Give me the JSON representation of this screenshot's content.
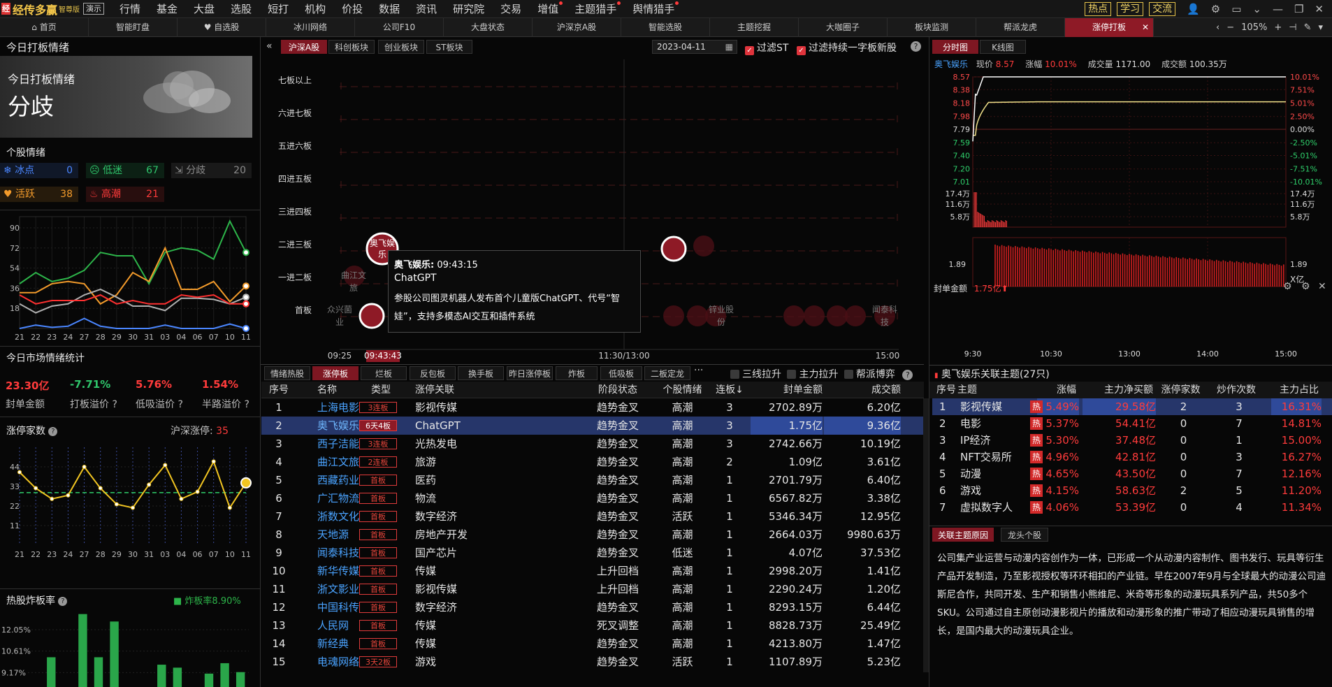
{
  "app": {
    "logo_mark": "经",
    "brand": "经传多赢",
    "edition": "智尊版",
    "demo": "演示"
  },
  "menu": [
    {
      "label": "行情",
      "hot": false
    },
    {
      "label": "基金",
      "hot": false
    },
    {
      "label": "大盘",
      "hot": false
    },
    {
      "label": "选股",
      "hot": false
    },
    {
      "label": "短打",
      "hot": false
    },
    {
      "label": "机构",
      "hot": false
    },
    {
      "label": "价投",
      "hot": false
    },
    {
      "label": "数据",
      "hot": false
    },
    {
      "label": "资讯",
      "hot": false
    },
    {
      "label": "研究院",
      "hot": false
    },
    {
      "label": "交易",
      "hot": false
    },
    {
      "label": "增值",
      "hot": true
    },
    {
      "label": "主题猎手",
      "hot": true
    },
    {
      "label": "舆情猎手",
      "hot": true
    }
  ],
  "top_buttons": [
    "热点",
    "学习",
    "交流"
  ],
  "tabs": [
    "首页",
    "智能盯盘",
    "自选股",
    "冰川网络",
    "公司F10",
    "大盘状态",
    "沪深京A股",
    "智能选股",
    "主题挖掘",
    "大咖圈子",
    "板块监测",
    "帮派龙虎",
    "涨停打板"
  ],
  "zoom": "105%",
  "left": {
    "title": "今日打板情绪",
    "mood_card": {
      "subtitle": "今日打板情绪",
      "mood": "分歧"
    },
    "stock_mood_title": "个股情绪",
    "mood_tags": [
      {
        "label": "冰点",
        "value": "0",
        "color": "#4a86ff"
      },
      {
        "label": "低迷",
        "value": "67",
        "color": "#2fc46b"
      },
      {
        "label": "分歧",
        "value": "20",
        "color": "#8c8c8c"
      },
      {
        "label": "活跃",
        "value": "38",
        "color": "#f39b2b"
      },
      {
        "label": "高潮",
        "value": "21",
        "color": "#ff3b3b"
      }
    ],
    "mood_chart": {
      "y_ticks": [
        "90",
        "72",
        "54",
        "36",
        "18"
      ],
      "x_ticks": [
        "21",
        "22",
        "23",
        "24",
        "27",
        "28",
        "29",
        "30",
        "31",
        "03",
        "04",
        "06",
        "07",
        "10",
        "11"
      ],
      "series": [
        {
          "name": "低迷",
          "color": "#2db54a",
          "values": [
            40,
            50,
            42,
            45,
            52,
            68,
            65,
            65,
            40,
            68,
            72,
            70,
            62,
            96,
            68
          ]
        },
        {
          "name": "活跃",
          "color": "#f39b2b",
          "values": [
            32,
            32,
            40,
            42,
            40,
            22,
            30,
            50,
            42,
            72,
            35,
            35,
            42,
            24,
            38
          ]
        },
        {
          "name": "分歧",
          "color": "#b0b0b0",
          "values": [
            22,
            14,
            20,
            22,
            30,
            35,
            28,
            20,
            20,
            16,
            27,
            27,
            26,
            22,
            28
          ]
        },
        {
          "name": "高潮",
          "color": "#ff3030",
          "values": [
            30,
            22,
            25,
            25,
            25,
            30,
            22,
            25,
            22,
            22,
            30,
            28,
            30,
            22,
            22
          ]
        },
        {
          "name": "冰点",
          "color": "#4a86ff",
          "values": [
            0,
            3,
            1,
            2,
            9,
            2,
            0,
            0,
            0,
            3,
            0,
            0,
            0,
            4,
            0
          ]
        }
      ]
    },
    "market_stats_title": "今日市场情绪统计",
    "market_stats": [
      {
        "value": "23.30亿",
        "label": "封单金额",
        "color": "#ff3b3b"
      },
      {
        "value": "-7.71%",
        "label": "打板溢价",
        "color": "#2fc46b"
      },
      {
        "value": "5.76%",
        "label": "低吸溢价",
        "color": "#ff3b3b"
      },
      {
        "value": "1.54%",
        "label": "半路溢价",
        "color": "#ff3b3b"
      }
    ],
    "limit_count_title": "涨停家数",
    "limit_count_label": "沪深涨停:",
    "limit_count_value": "35",
    "limit_chart": {
      "y_ticks": [
        "44",
        "33",
        "22",
        "11"
      ],
      "x_ticks": [
        "21",
        "22",
        "23",
        "24",
        "27",
        "28",
        "29",
        "30",
        "31",
        "03",
        "04",
        "06",
        "07",
        "10",
        "11"
      ],
      "values": [
        41,
        32,
        26,
        28,
        44,
        32,
        23,
        21,
        34,
        45,
        26,
        30,
        47,
        21,
        35
      ],
      "avg": 29.5
    },
    "bomb_title": "热股炸板率",
    "bomb_legend": "炸板率8.90%",
    "bomb_chart": {
      "y_ticks": [
        "12.05%",
        "10.61%",
        "9.17%"
      ],
      "values": [
        0,
        10.2,
        0,
        13.1,
        10.2,
        12.6,
        0,
        0,
        9.7,
        9.5,
        0,
        9.1,
        9.8,
        9.2
      ]
    }
  },
  "middle": {
    "boards": [
      "沪深A股",
      "科创板块",
      "创业板块",
      "ST板块"
    ],
    "date": "2023-04-11",
    "filter1": "过滤ST",
    "filter2": "过滤持续一字板新股",
    "levels": [
      "七板以上",
      "六进七板",
      "五进六板",
      "四进五板",
      "三进四板",
      "二进三板",
      "一进二板",
      "首板"
    ],
    "time_axis": [
      "09:25",
      "09:43:43",
      "11:30/13:00",
      "15:00"
    ],
    "bubble_labels": [
      "奥飞娱乐",
      "曲江文旅",
      "众兴菌业",
      "锌业股份",
      "闻泰科技"
    ],
    "tooltip": {
      "name": "奥飞娱乐:",
      "time": "09:43:15",
      "topic": "ChatGPT",
      "text": "参股公司图灵机器人发布首个儿童版ChatGPT、代号“智娃”，支持多模态AI交互和插件系统"
    },
    "list_tabs": [
      "情绪热股",
      "涨停板",
      "烂板",
      "反包板",
      "换手板",
      "昨日涨停板",
      "炸板",
      "低吸板",
      "二板定龙"
    ],
    "list_more": "···",
    "list_checks": [
      "三线拉升",
      "主力拉升",
      "帮派博弈"
    ],
    "headers": [
      "序号",
      "名称",
      "类型",
      "涨停关联",
      "阶段状态",
      "个股情绪",
      "连板↓",
      "封单金额",
      "成交额"
    ],
    "rows": [
      {
        "no": "1",
        "name": "上海电影",
        "type": "3连板",
        "topic": "影视传媒",
        "stage": "趋势金叉",
        "mood": "高潮",
        "boards": "3",
        "seal": "2702.89万",
        "amount": "6.20亿"
      },
      {
        "no": "2",
        "name": "奥飞娱乐",
        "type": "6天4板",
        "topic": "ChatGPT",
        "stage": "趋势金叉",
        "mood": "高潮",
        "boards": "3",
        "seal": "1.75亿",
        "amount": "9.36亿"
      },
      {
        "no": "3",
        "name": "西子洁能",
        "type": "3连板",
        "topic": "光热发电",
        "stage": "趋势金叉",
        "mood": "高潮",
        "boards": "3",
        "seal": "2742.66万",
        "amount": "10.19亿"
      },
      {
        "no": "4",
        "name": "曲江文旅",
        "type": "2连板",
        "topic": "旅游",
        "stage": "趋势金叉",
        "mood": "高潮",
        "boards": "2",
        "seal": "1.09亿",
        "amount": "3.61亿"
      },
      {
        "no": "5",
        "name": "西藏药业",
        "type": "首板",
        "topic": "医药",
        "stage": "趋势金叉",
        "mood": "高潮",
        "boards": "1",
        "seal": "2701.79万",
        "amount": "6.40亿"
      },
      {
        "no": "6",
        "name": "广汇物流",
        "type": "首板",
        "topic": "物流",
        "stage": "趋势金叉",
        "mood": "高潮",
        "boards": "1",
        "seal": "6567.82万",
        "amount": "3.38亿"
      },
      {
        "no": "7",
        "name": "浙数文化",
        "type": "首板",
        "topic": "数字经济",
        "stage": "趋势金叉",
        "mood": "活跃",
        "boards": "1",
        "seal": "5346.34万",
        "amount": "12.95亿"
      },
      {
        "no": "8",
        "name": "天地源",
        "type": "首板",
        "topic": "房地产开发",
        "stage": "趋势金叉",
        "mood": "高潮",
        "boards": "1",
        "seal": "2664.03万",
        "amount": "9980.63万"
      },
      {
        "no": "9",
        "name": "闻泰科技",
        "type": "首板",
        "topic": "国产芯片",
        "stage": "趋势金叉",
        "mood": "低迷",
        "boards": "1",
        "seal": "4.07亿",
        "amount": "37.53亿"
      },
      {
        "no": "10",
        "name": "新华传媒",
        "type": "首板",
        "topic": "传媒",
        "stage": "上升回档",
        "mood": "高潮",
        "boards": "1",
        "seal": "2998.20万",
        "amount": "1.41亿"
      },
      {
        "no": "11",
        "name": "浙文影业",
        "type": "首板",
        "topic": "影视传媒",
        "stage": "上升回档",
        "mood": "高潮",
        "boards": "1",
        "seal": "2290.24万",
        "amount": "1.20亿"
      },
      {
        "no": "12",
        "name": "中国科传",
        "type": "首板",
        "topic": "数字经济",
        "stage": "趋势金叉",
        "mood": "高潮",
        "boards": "1",
        "seal": "8293.15万",
        "amount": "6.44亿"
      },
      {
        "no": "13",
        "name": "人民网",
        "type": "首板",
        "topic": "传媒",
        "stage": "死叉调整",
        "mood": "高潮",
        "boards": "1",
        "seal": "8828.73万",
        "amount": "25.49亿"
      },
      {
        "no": "14",
        "name": "新经典",
        "type": "首板",
        "topic": "传媒",
        "stage": "趋势金叉",
        "mood": "高潮",
        "boards": "1",
        "seal": "4213.80万",
        "amount": "1.47亿"
      },
      {
        "no": "15",
        "name": "电魂网络",
        "type": "3天2板",
        "topic": "游戏",
        "stage": "趋势金叉",
        "mood": "活跃",
        "boards": "1",
        "seal": "1107.89万",
        "amount": "5.23亿"
      }
    ]
  },
  "right": {
    "tabs": [
      "分时图",
      "K线图"
    ],
    "stock_name": "奥飞娱乐",
    "price_label": "现价",
    "price": "8.57",
    "chg_label": "涨幅",
    "chg": "10.01%",
    "vol_label": "成交量",
    "vol": "1171.00",
    "amt_label": "成交额",
    "amt": "100.35万",
    "price_ticks": [
      "8.57",
      "8.38",
      "8.18",
      "7.98",
      "7.79",
      "7.59",
      "7.40",
      "7.20",
      "7.01"
    ],
    "pct_ticks": [
      "10.01%",
      "7.51%",
      "5.01%",
      "2.50%",
      "0.00%",
      "-2.50%",
      "-5.01%",
      "-7.51%",
      "-10.01%"
    ],
    "vol_ticks": [
      "17.4万",
      "11.6万",
      "5.8万"
    ],
    "seal_title": "封单金额",
    "seal_value": "1.75亿",
    "seal_tick": "1.89",
    "seal_unit": "X亿",
    "time_ticks": [
      "9:30",
      "10:30",
      "13:00",
      "14:00",
      "15:00"
    ],
    "topic_title": "奥飞娱乐关联主题(27只)",
    "topic_headers": [
      "序号",
      "主题",
      "涨幅",
      "主力净买额",
      "涨停家数",
      "炒作次数",
      "主力占比"
    ],
    "topics": [
      {
        "no": "1",
        "name": "影视传媒",
        "chg": "5.49%",
        "net": "29.58亿",
        "limit": "2",
        "times": "3",
        "ratio": "16.31%"
      },
      {
        "no": "2",
        "name": "电影",
        "chg": "5.37%",
        "net": "54.41亿",
        "limit": "0",
        "times": "7",
        "ratio": "14.81%"
      },
      {
        "no": "3",
        "name": "IP经济",
        "chg": "5.30%",
        "net": "37.48亿",
        "limit": "0",
        "times": "1",
        "ratio": "15.00%"
      },
      {
        "no": "4",
        "name": "NFT交易所",
        "chg": "4.96%",
        "net": "42.81亿",
        "limit": "0",
        "times": "3",
        "ratio": "16.27%"
      },
      {
        "no": "5",
        "name": "动漫",
        "chg": "4.65%",
        "net": "43.50亿",
        "limit": "0",
        "times": "7",
        "ratio": "12.16%"
      },
      {
        "no": "6",
        "name": "游戏",
        "chg": "4.15%",
        "net": "58.63亿",
        "limit": "2",
        "times": "5",
        "ratio": "11.20%"
      },
      {
        "no": "7",
        "name": "虚拟数字人",
        "chg": "4.06%",
        "net": "53.39亿",
        "limit": "0",
        "times": "4",
        "ratio": "11.34%"
      }
    ],
    "hot_label": "热",
    "reason_tabs": [
      "关联主题原因",
      "龙头个股"
    ],
    "reason_text": "公司集产业运营与动漫内容创作为一体，已形成一个从动漫内容制作、图书发行、玩具等衍生产品开发制造，乃至影视授权等环环相扣的产业链。早在2007年9月与全球最大的动漫公司迪斯尼合作，共同开发、生产和销售小熊维尼、米奇等形象的动漫玩具系列产品，共50多个SKU。公司通过自主原创动漫影视片的播放和动漫形象的推广带动了相应动漫玩具销售的增长，是国内最大的动漫玩具企业。"
  }
}
